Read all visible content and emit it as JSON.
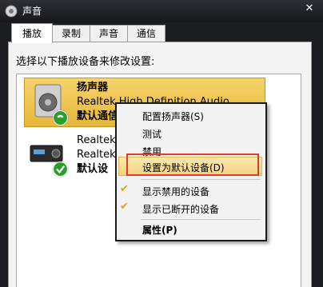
{
  "window": {
    "title": "声音",
    "close_glyph": "✕"
  },
  "tabs": [
    {
      "label": "播放",
      "active": true
    },
    {
      "label": "录制",
      "active": false
    },
    {
      "label": "声音",
      "active": false
    },
    {
      "label": "通信",
      "active": false
    }
  ],
  "instruction": "选择以下播放设备来修改设置:",
  "devices": [
    {
      "name": "扬声器",
      "driver": "Realtek High Definition Audio",
      "status": "默认通信设备",
      "icon": "speaker-icon",
      "badge": "phone-badge-icon",
      "selected": true
    },
    {
      "name": "Realtek",
      "driver": "Realtek",
      "status": "默认设",
      "icon": "receiver-icon",
      "badge": "check-badge-icon",
      "selected": false
    }
  ],
  "context_menu": {
    "items": [
      {
        "label": "配置扬声器(S)"
      },
      {
        "label": "测试"
      },
      {
        "label": "禁用"
      },
      {
        "label": "设置为默认设备(D)",
        "highlighted": true
      },
      {
        "label": "显示禁用的设备",
        "checked": true
      },
      {
        "label": "显示已断开的设备",
        "checked": true
      },
      {
        "label": "属性(P)",
        "bold": true
      }
    ]
  },
  "colors": {
    "selection": "#e6b73c",
    "annotation": "#e03a2c",
    "phone_badge": "#2aa02a",
    "check_badge": "#2aa02a"
  }
}
